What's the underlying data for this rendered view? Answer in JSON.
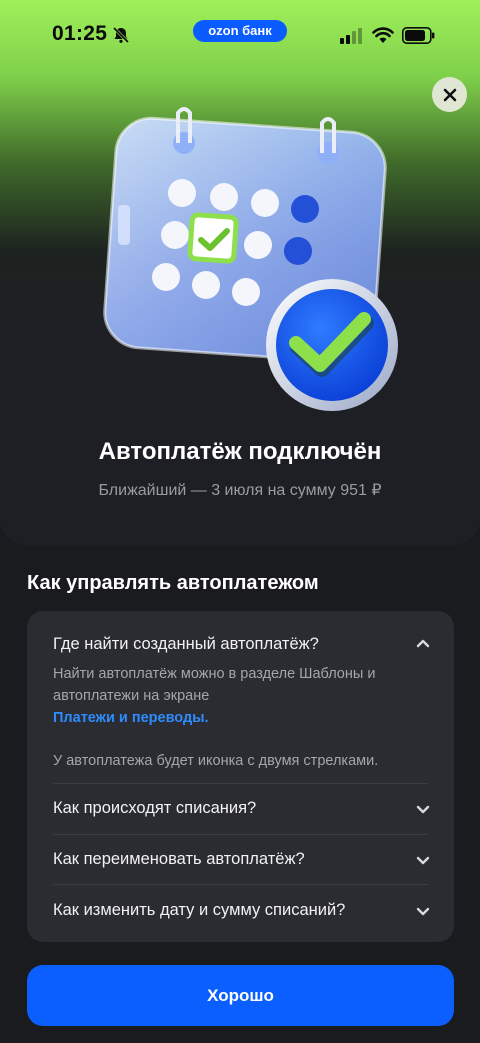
{
  "status_bar": {
    "time": "01:25",
    "bank_badge": "ozon банк",
    "icons": [
      "bell-muted-icon",
      "signal-icon",
      "wifi-icon",
      "battery-icon"
    ]
  },
  "hero": {
    "title": "Автоплатёж подключён",
    "subtitle": "Ближайший — 3 июля на сумму 951 ₽",
    "close_icon": "close-icon",
    "illustration": "calendar-check-illustration"
  },
  "manage": {
    "title": "Как управлять автоплатежом",
    "items": [
      {
        "question": "Где найти созданный автоплатёж?",
        "expanded": true,
        "answer_line1": "Найти автоплатёж можно в разделе Шаблоны и автоплатежи на экране",
        "answer_link": "Платежи и переводы.",
        "answer_line2": "У автоплатежа будет иконка с двумя стрелками."
      },
      {
        "question": "Как происходят списания?",
        "expanded": false
      },
      {
        "question": "Как переименовать автоплатёж?",
        "expanded": false
      },
      {
        "question": "Как изменить дату и сумму списаний?",
        "expanded": false
      }
    ]
  },
  "primary_button": "Хорошо",
  "colors": {
    "accent_blue": "#0b5fff",
    "link_blue": "#2d8dff",
    "hero_green": "#9ff05a",
    "card_bg": "#2a2c31"
  }
}
